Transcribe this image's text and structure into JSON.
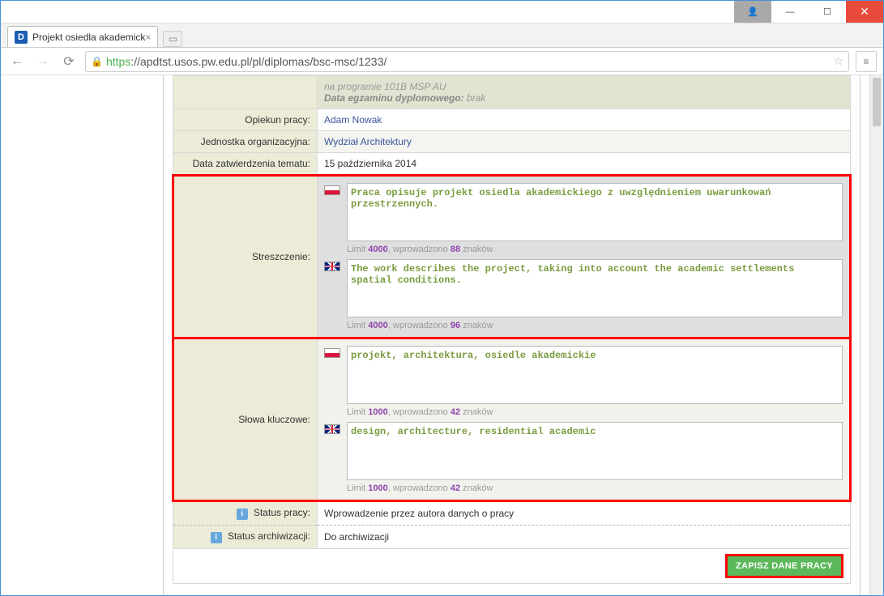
{
  "browser": {
    "tab_title": "Projekt osiedla akademick",
    "url_scheme": "https",
    "url_rest": "://apdtst.usos.pw.edu.pl/pl/diplomas/bsc-msc/1233/"
  },
  "top_info": {
    "program_line": "na programie 101B MSP AU",
    "exam_label": "Data egzaminu dyplomowego:",
    "exam_value": "brak"
  },
  "rows": {
    "supervisor_label": "Opiekun pracy:",
    "supervisor_value": "Adam Nowak",
    "unit_label": "Jednostka organizacyjna:",
    "unit_value": "Wydział Architektury",
    "approval_label": "Data zatwierdzenia tematu:",
    "approval_value": "15 października 2014"
  },
  "abstract": {
    "label": "Streszczenie:",
    "pl_text": "Praca opisuje projekt osiedla akademickiego z uwzględnieniem uwarunkowań przestrzennych.",
    "pl_limit_pre": "Limit",
    "pl_limit_num": "4000",
    "pl_limit_mid": ", wprowadzono",
    "pl_count": "88",
    "pl_limit_suf": "znaków",
    "en_text": "The work describes the project, taking into account the academic settlements spatial conditions.",
    "en_limit_num": "4000",
    "en_count": "96"
  },
  "keywords": {
    "label": "Słowa kluczowe:",
    "pl_text": "projekt, architektura, osiedle akademickie",
    "pl_limit_num": "1000",
    "pl_count": "42",
    "en_text": "design, architecture, residential academic",
    "en_limit_num": "1000",
    "en_count": "42"
  },
  "status": {
    "work_label": "Status pracy:",
    "work_value": "Wprowadzenie przez autora danych o pracy",
    "arch_label": "Status archiwizacji:",
    "arch_value": "Do archiwizacji"
  },
  "save_button": "ZAPISZ DANE PRACY"
}
